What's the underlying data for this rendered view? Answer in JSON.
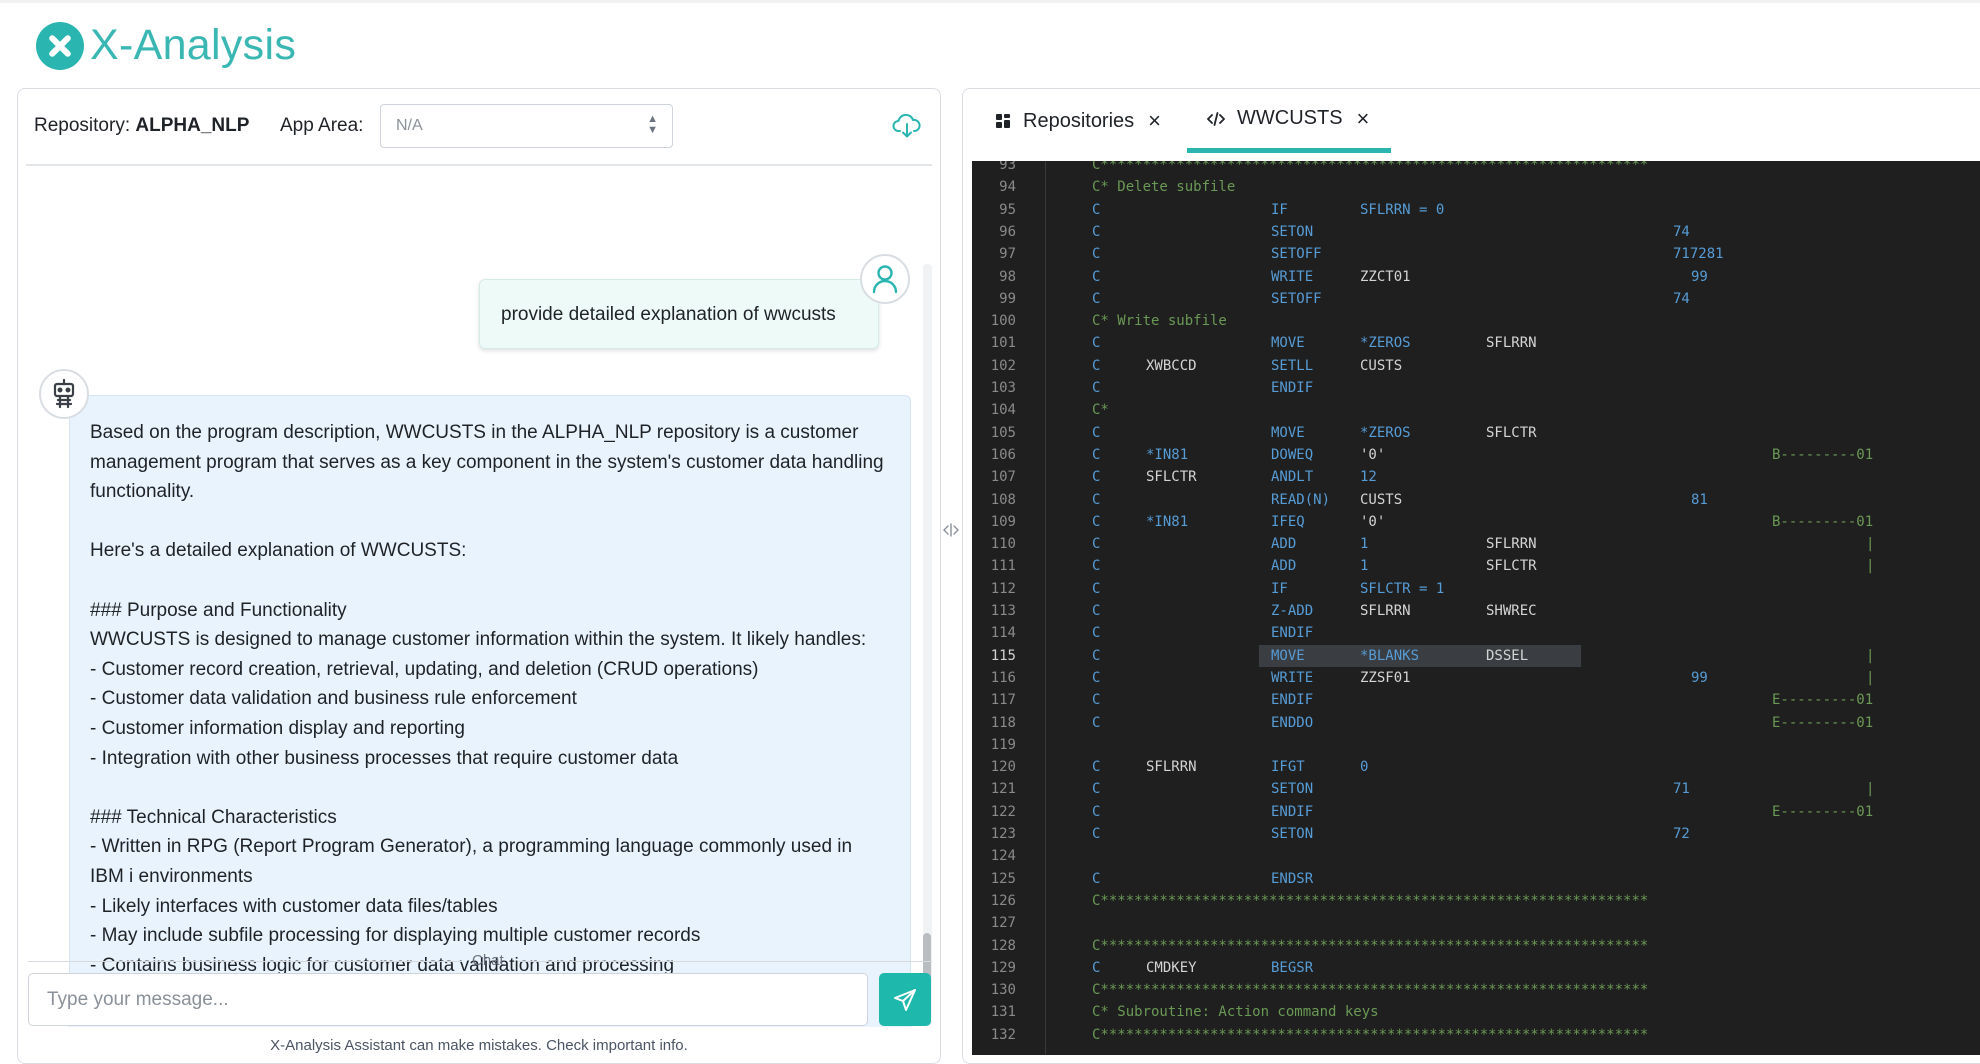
{
  "app": {
    "title": "X-Analysis"
  },
  "repo_bar": {
    "repository_label": "Repository:",
    "repository_value": "ALPHA_NLP",
    "app_area_label": "App Area:",
    "app_area_value": "N/A"
  },
  "chat": {
    "user_message": "provide detailed explanation of wwcusts",
    "bot_message": "Based on the program description, WWCUSTS in the ALPHA_NLP repository is a customer management program that serves as a key component in the system's customer data handling functionality.\n\nHere's a detailed explanation of WWCUSTS:\n\n### Purpose and Functionality\nWWCUSTS is designed to manage customer information within the system. It likely handles:\n- Customer record creation, retrieval, updating, and deletion (CRUD operations)\n- Customer data validation and business rule enforcement\n- Customer information display and reporting\n- Integration with other business processes that require customer data\n\n### Technical Characteristics\n- Written in RPG (Report Program Generator), a programming language commonly used in IBM i environments\n- Likely interfaces with customer data files/tables\n- May include subfile processing for displaying multiple customer records\n- Contains business logic for customer data validation and processing",
    "section_label": "Chat",
    "input_placeholder": "Type your message...",
    "disclaimer": "X-Analysis Assistant can make mistakes. Check important info."
  },
  "tabs": [
    {
      "label": "Repositories",
      "icon": "grid-icon"
    },
    {
      "label": "WWCUSTS",
      "icon": "code-icon",
      "active": true
    }
  ],
  "colors": {
    "accent": "#2bb5b0",
    "code_bg": "#1f1f1f"
  },
  "code": {
    "current_line": 115,
    "lines": [
      {
        "n": 93,
        "kind": "comment",
        "text": "C*****************************************************************"
      },
      {
        "n": 94,
        "kind": "comment",
        "text": "C* Delete subfile"
      },
      {
        "n": 95,
        "c": "C",
        "op": "IF",
        "f1": "SFLRRN = 0",
        "f1c": "op"
      },
      {
        "n": 96,
        "c": "C",
        "op": "SETON",
        "ind": "74"
      },
      {
        "n": 97,
        "c": "C",
        "op": "SETOFF",
        "ind": "717281"
      },
      {
        "n": 98,
        "c": "C",
        "op": "WRITE",
        "f1": "ZZCT01",
        "ind2": "99"
      },
      {
        "n": 99,
        "c": "C",
        "op": "SETOFF",
        "ind": "74"
      },
      {
        "n": 100,
        "kind": "comment",
        "text": "C* Write subfile"
      },
      {
        "n": 101,
        "c": "C",
        "op": "MOVE",
        "f1": "*ZEROS",
        "f1c": "op",
        "res": "SFLRRN"
      },
      {
        "n": 102,
        "c": "C",
        "fac": "XWBCCD",
        "op": "SETLL",
        "f1": "CUSTS"
      },
      {
        "n": 103,
        "c": "C",
        "op": "ENDIF"
      },
      {
        "n": 104,
        "kind": "comment",
        "text": "C*"
      },
      {
        "n": 105,
        "c": "C",
        "op": "MOVE",
        "f1": "*ZEROS",
        "f1c": "op",
        "res": "SFLCTR"
      },
      {
        "n": 106,
        "c": "C",
        "fac": "*IN81",
        "facc": "op",
        "op": "DOWEQ",
        "f1": "'0'",
        "marker": "B---------01"
      },
      {
        "n": 107,
        "c": "C",
        "fac": "SFLCTR",
        "op": "ANDLT",
        "f1": "12",
        "f1c": "op"
      },
      {
        "n": 108,
        "c": "C",
        "op": "READ(N)",
        "f1": "CUSTS",
        "ind2": "81"
      },
      {
        "n": 109,
        "c": "C",
        "fac": "*IN81",
        "facc": "op",
        "op": "IFEQ",
        "f1": "'0'",
        "marker": "B---------01"
      },
      {
        "n": 110,
        "c": "C",
        "op": "ADD",
        "f1": "1",
        "f1c": "op",
        "res": "SFLRRN",
        "bar": "|"
      },
      {
        "n": 111,
        "c": "C",
        "op": "ADD",
        "f1": "1",
        "f1c": "op",
        "res": "SFLCTR",
        "bar": "|"
      },
      {
        "n": 112,
        "c": "C",
        "op": "IF",
        "f1": "SFLCTR = 1",
        "f1c": "op"
      },
      {
        "n": 113,
        "c": "C",
        "op": "Z-ADD",
        "f1": "SFLRRN",
        "res": "SHWREC"
      },
      {
        "n": 114,
        "c": "C",
        "op": "ENDIF"
      },
      {
        "n": 115,
        "c": "C",
        "op": "MOVE",
        "f1": "*BLANKS",
        "f1c": "op",
        "res": "DSSEL",
        "bar": "|",
        "selected": true
      },
      {
        "n": 116,
        "c": "C",
        "op": "WRITE",
        "f1": "ZZSF01",
        "ind2": "99",
        "bar": "|"
      },
      {
        "n": 117,
        "c": "C",
        "op": "ENDIF",
        "marker": "E---------01"
      },
      {
        "n": 118,
        "c": "C",
        "op": "ENDDO",
        "marker": "E---------01"
      },
      {
        "n": 119
      },
      {
        "n": 120,
        "c": "C",
        "fac": "SFLRRN",
        "op": "IFGT",
        "f1": "0",
        "f1c": "op"
      },
      {
        "n": 121,
        "c": "C",
        "op": "SETON",
        "ind": "71",
        "bar": "|"
      },
      {
        "n": 122,
        "c": "C",
        "op": "ENDIF",
        "marker": "E---------01"
      },
      {
        "n": 123,
        "c": "C",
        "op": "SETON",
        "ind": "72"
      },
      {
        "n": 124
      },
      {
        "n": 125,
        "c": "C",
        "op": "ENDSR"
      },
      {
        "n": 126,
        "kind": "comment",
        "text": "C*****************************************************************"
      },
      {
        "n": 127
      },
      {
        "n": 128,
        "kind": "comment",
        "text": "C*****************************************************************"
      },
      {
        "n": 129,
        "c": "C",
        "fac": "CMDKEY",
        "op": "BEGSR"
      },
      {
        "n": 130,
        "kind": "comment",
        "text": "C*****************************************************************"
      },
      {
        "n": 131,
        "kind": "comment",
        "text": "C* Subroutine: Action command keys"
      },
      {
        "n": 132,
        "kind": "comment",
        "text": "C*****************************************************************"
      }
    ]
  }
}
